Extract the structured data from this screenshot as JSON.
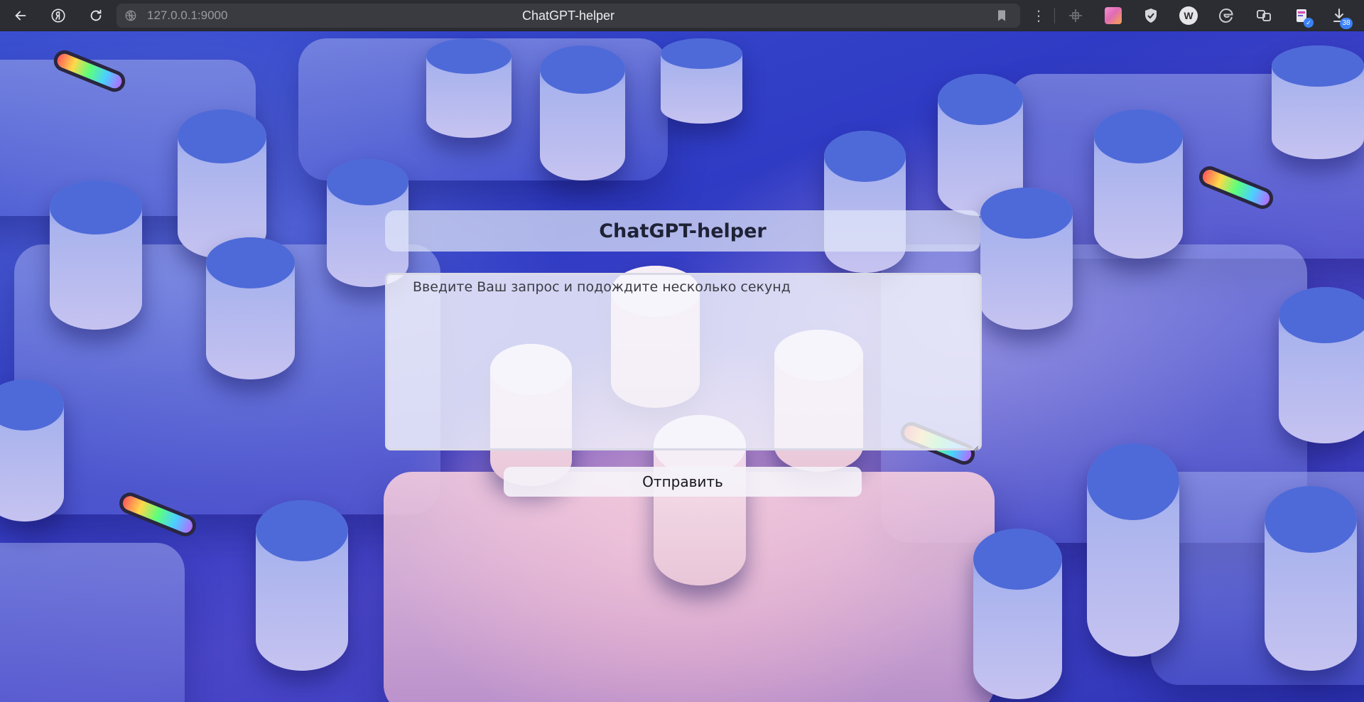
{
  "browser": {
    "url": "127.0.0.1:9000",
    "tab_title": "ChatGPT-helper",
    "extensions_badge_count": "38",
    "extension_w_label": "W"
  },
  "app": {
    "title": "ChatGPT-helper",
    "query_placeholder": "Введите Ваш запрос и подождите несколько секунд",
    "query_value": "",
    "send_label": "Отправить"
  },
  "colors": {
    "chrome_bg": "#2c2d33",
    "omnibox_bg": "#3a3b41",
    "badge_blue": "#3b82f6"
  }
}
